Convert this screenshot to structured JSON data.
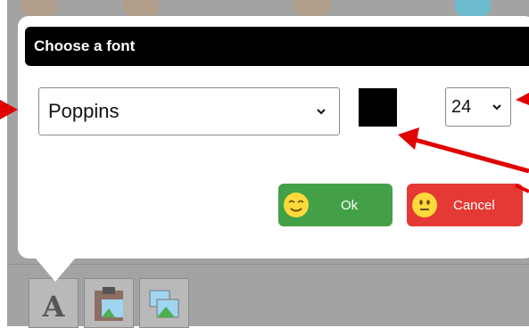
{
  "dialog": {
    "title": "Choose a font",
    "font_select": {
      "value": "Poppins"
    },
    "text_color": "#000000",
    "size_select": {
      "value": "24"
    },
    "ok_label": "Ok",
    "cancel_label": "Cancel"
  },
  "toolbar": {
    "tools": [
      {
        "name": "text-tool",
        "glyph": "A"
      },
      {
        "name": "paste-image-tool"
      },
      {
        "name": "images-tool"
      }
    ]
  },
  "colors": {
    "ok": "#43a047",
    "cancel": "#e53935",
    "annotation": "#e00000"
  }
}
